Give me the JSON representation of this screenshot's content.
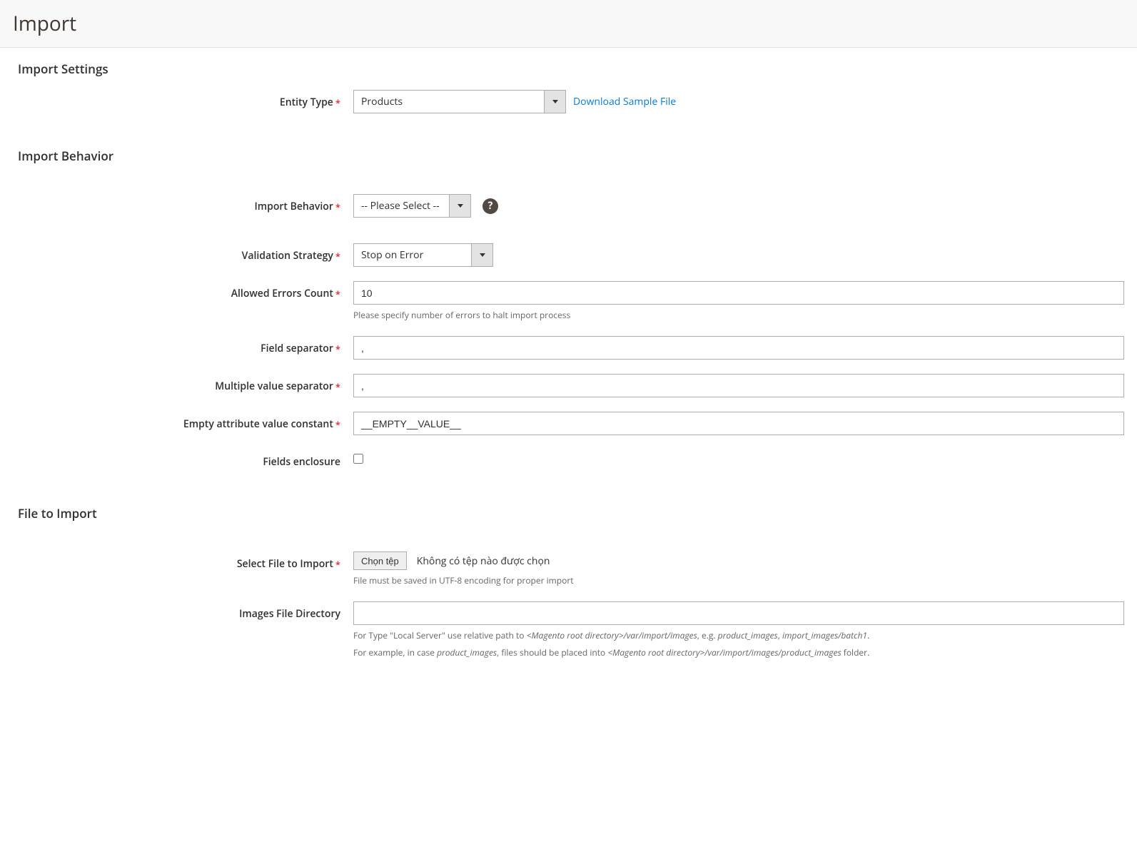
{
  "page": {
    "title": "Import"
  },
  "sections": {
    "settings": {
      "title": "Import Settings",
      "entity_type": {
        "label": "Entity Type",
        "value": "Products",
        "sample_link": "Download Sample File"
      }
    },
    "behavior": {
      "title": "Import Behavior",
      "import_behavior": {
        "label": "Import Behavior",
        "value": "-- Please Select --"
      },
      "validation_strategy": {
        "label": "Validation Strategy",
        "value": "Stop on Error"
      },
      "allowed_errors": {
        "label": "Allowed Errors Count",
        "value": "10",
        "hint": "Please specify number of errors to halt import process"
      },
      "field_separator": {
        "label": "Field separator",
        "value": ","
      },
      "multi_separator": {
        "label": "Multiple value separator",
        "value": ","
      },
      "empty_const": {
        "label": "Empty attribute value constant",
        "value": "__EMPTY__VALUE__"
      },
      "fields_enclosure": {
        "label": "Fields enclosure"
      }
    },
    "file": {
      "title": "File to Import",
      "select_file": {
        "label": "Select File to Import",
        "button": "Chọn tệp",
        "status": "Không có tệp nào được chọn",
        "hint": "File must be saved in UTF-8 encoding for proper import"
      },
      "images_dir": {
        "label": "Images File Directory",
        "value": "",
        "hint1_a": "For Type \"Local Server\" use relative path to ",
        "hint1_b": "<Magento root directory>/var/import/images",
        "hint1_c": ", e.g. ",
        "hint1_d": "product_images",
        "hint1_e": ", ",
        "hint1_f": "import_images/batch1",
        "hint1_g": ".",
        "hint2_a": "For example, in case ",
        "hint2_b": "product_images",
        "hint2_c": ", files should be placed into ",
        "hint2_d": "<Magento root directory>/var/import/images/product_images",
        "hint2_e": " folder."
      }
    }
  }
}
